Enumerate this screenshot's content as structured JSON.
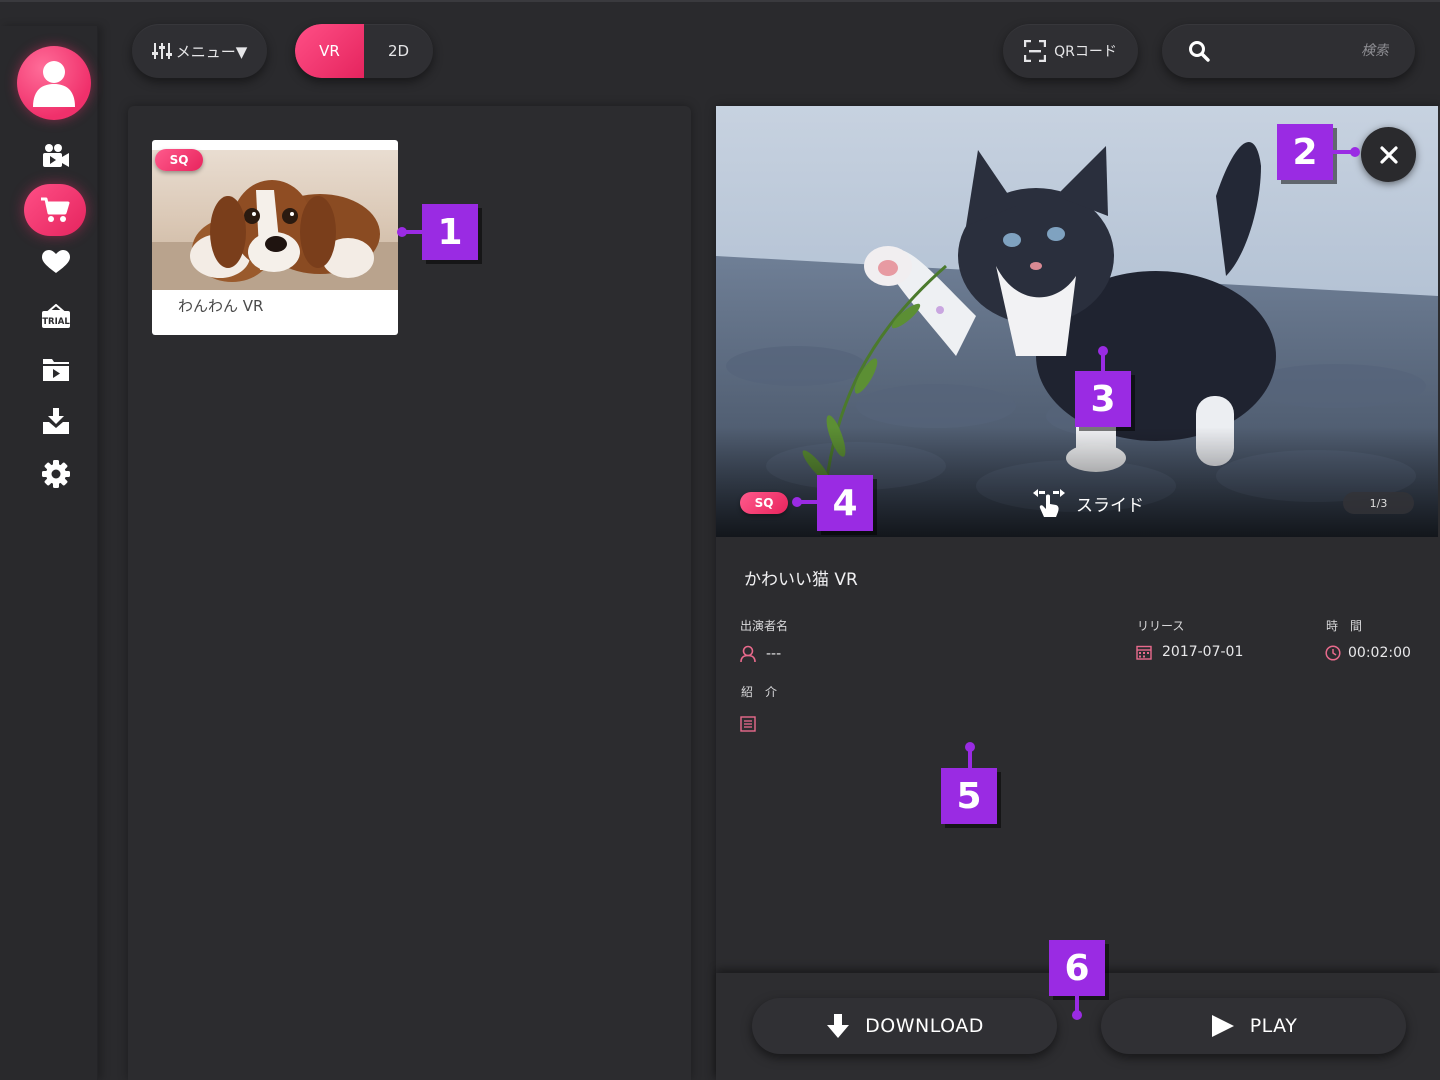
{
  "topbar": {
    "menu_label": "メニュー▼",
    "toggle": [
      "VR",
      "2D"
    ],
    "qr_label": "QRコード",
    "search_placeholder": "検索"
  },
  "sidebar": {
    "icons": [
      "avatar-icon",
      "video-camera-icon",
      "cart-icon",
      "heart-icon",
      "trial-icon",
      "folder-play-icon",
      "download-tray-icon",
      "gear-icon"
    ],
    "trial_text": "TRIAL",
    "active": "cart-icon"
  },
  "list": {
    "items": [
      {
        "title": "わんわん VR",
        "badge": "SQ"
      }
    ]
  },
  "detail": {
    "badge": "SQ",
    "slide_hint": "スライド",
    "counter": "1/3",
    "title": "かわいい猫 VR",
    "performer_label": "出演者名",
    "performer_value": "---",
    "release_label": "リリース",
    "release_value": "2017-07-01",
    "time_label": "時　間",
    "time_value": "00:02:00",
    "intro_label": "紹　介"
  },
  "actions": {
    "download_label": "DOWNLOAD",
    "play_label": "PLAY"
  },
  "callouts": [
    "1",
    "2",
    "3",
    "4",
    "5",
    "6"
  ],
  "colors": {
    "accent": "#f0306b",
    "callout": "#9a2be3",
    "background": "#2a2a2d"
  }
}
